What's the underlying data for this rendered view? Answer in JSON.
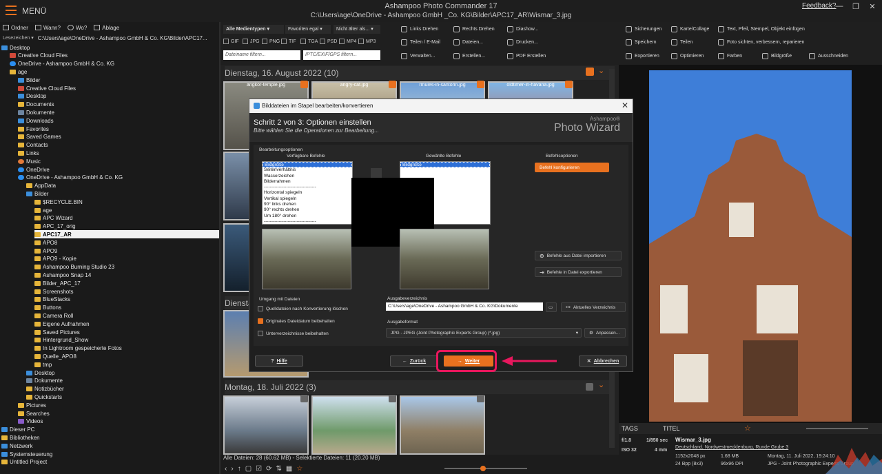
{
  "titlebar": {
    "menu_label": "MENÜ",
    "app_title": "Ashampoo Photo Commander 17",
    "path": "C:\\Users\\age\\OneDrive - Ashampoo GmbH _Co. KG\\Bilder\\APC17_AR\\Wismar_3.jpg",
    "feedback": "Feedback?",
    "minimize": "—",
    "restore": "❐",
    "close": "✕"
  },
  "left": {
    "toolbar": {
      "ordner": "Ordner",
      "wann": "Wann?",
      "wo": "Wo?",
      "ablage": "Ablage"
    },
    "bookmark_label": "Lesezeichen ▾",
    "bookmark_path": "C:\\Users\\age\\OneDrive - Ashampoo GmbH & Co. KG\\Bilder\\APC17...",
    "tree": [
      {
        "label": "Desktop",
        "indent": 0,
        "icon": "blue"
      },
      {
        "label": "Creative Cloud Files",
        "indent": 1,
        "icon": "red"
      },
      {
        "label": "OneDrive - Ashampoo GmbH & Co. KG",
        "indent": 1,
        "icon": "cloud"
      },
      {
        "label": "age",
        "indent": 1,
        "icon": "folder"
      },
      {
        "label": "Bilder",
        "indent": 2,
        "icon": "blue"
      },
      {
        "label": "Creative Cloud Files",
        "indent": 2,
        "icon": "red"
      },
      {
        "label": "Desktop",
        "indent": 2,
        "icon": "blue"
      },
      {
        "label": "Documents",
        "indent": 2,
        "icon": "folder"
      },
      {
        "label": "Dokumente",
        "indent": 2,
        "icon": "gray"
      },
      {
        "label": "Downloads",
        "indent": 2,
        "icon": "blue"
      },
      {
        "label": "Favorites",
        "indent": 2,
        "icon": "folder"
      },
      {
        "label": "Saved Games",
        "indent": 2,
        "icon": "folder"
      },
      {
        "label": "Contacts",
        "indent": 2,
        "icon": "folder"
      },
      {
        "label": "Links",
        "indent": 2,
        "icon": "folder"
      },
      {
        "label": "Music",
        "indent": 2,
        "icon": "music"
      },
      {
        "label": "OneDrive",
        "indent": 2,
        "icon": "cloud"
      },
      {
        "label": "OneDrive - Ashampoo GmbH & Co. KG",
        "indent": 2,
        "icon": "cloud"
      },
      {
        "label": "AppData",
        "indent": 3,
        "icon": "folder"
      },
      {
        "label": "Bilder",
        "indent": 3,
        "icon": "blue"
      },
      {
        "label": "$RECYCLE.BIN",
        "indent": 4,
        "icon": "folder"
      },
      {
        "label": "age",
        "indent": 4,
        "icon": "folder"
      },
      {
        "label": "APC Wizard",
        "indent": 4,
        "icon": "folder"
      },
      {
        "label": "APC_17_orig",
        "indent": 4,
        "icon": "folder"
      },
      {
        "label": "APC17_AR",
        "indent": 4,
        "icon": "folder",
        "selected": true
      },
      {
        "label": "APO8",
        "indent": 4,
        "icon": "folder"
      },
      {
        "label": "APO9",
        "indent": 4,
        "icon": "folder"
      },
      {
        "label": "APO9 - Kopie",
        "indent": 4,
        "icon": "folder"
      },
      {
        "label": "Ashampoo Burning Studio 23",
        "indent": 4,
        "icon": "folder"
      },
      {
        "label": "Ashampoo Snap 14",
        "indent": 4,
        "icon": "folder"
      },
      {
        "label": "Bilder_APC_17",
        "indent": 4,
        "icon": "folder"
      },
      {
        "label": "Screenshots",
        "indent": 4,
        "icon": "folder"
      },
      {
        "label": "BlueStacks",
        "indent": 4,
        "icon": "folder"
      },
      {
        "label": "Buttons",
        "indent": 4,
        "icon": "folder"
      },
      {
        "label": "Camera Roll",
        "indent": 4,
        "icon": "folder"
      },
      {
        "label": "Eigene Aufnahmen",
        "indent": 4,
        "icon": "folder"
      },
      {
        "label": "Saved Pictures",
        "indent": 4,
        "icon": "folder"
      },
      {
        "label": "Hintergrund_Show",
        "indent": 4,
        "icon": "folder"
      },
      {
        "label": "In Lightroom gespeicherte Fotos",
        "indent": 4,
        "icon": "folder"
      },
      {
        "label": "Quelle_APO8",
        "indent": 4,
        "icon": "folder"
      },
      {
        "label": "tmp",
        "indent": 4,
        "icon": "folder"
      },
      {
        "label": "Desktop",
        "indent": 3,
        "icon": "blue"
      },
      {
        "label": "Dokumente",
        "indent": 3,
        "icon": "gray"
      },
      {
        "label": "Notizbücher",
        "indent": 3,
        "icon": "folder"
      },
      {
        "label": "Quickstarts",
        "indent": 3,
        "icon": "folder"
      },
      {
        "label": "Pictures",
        "indent": 2,
        "icon": "folder"
      },
      {
        "label": "Searches",
        "indent": 2,
        "icon": "folder"
      },
      {
        "label": "Videos",
        "indent": 2,
        "icon": "purple"
      },
      {
        "label": "Dieser PC",
        "indent": 0,
        "icon": "blue"
      },
      {
        "label": "Bibliotheken",
        "indent": 0,
        "icon": "folder"
      },
      {
        "label": "Netzwerk",
        "indent": 0,
        "icon": "blue"
      },
      {
        "label": "Systemsteuerung",
        "indent": 0,
        "icon": "blue"
      },
      {
        "label": "Untitled Project",
        "indent": 0,
        "icon": "folder"
      }
    ]
  },
  "center_toolbar": {
    "media_type": "Alle Medientypen",
    "favorites": "Favoriten egal",
    "age": "Nicht älter als...",
    "formats": [
      "GIF",
      "JPG",
      "PNG",
      "TIF",
      "TGA",
      "PSD",
      "MP4",
      "MP3"
    ],
    "name_filter_placeholder": "Dateiname filtern...",
    "iptc_filter_placeholder": "IPTC/EXIF/GPS filtern...",
    "actions": [
      "Links Drehen",
      "Rechts Drehen",
      "Diashow...",
      "Teilen / E-Mail",
      "Dateien...",
      "Drucken...",
      "Verwalten...",
      "Erstellen...",
      "PDF Erstellen"
    ]
  },
  "right_toolbar": {
    "actions": [
      "Sicherungen",
      "Karte/Collage",
      "Text, Pfeil, Stempel, Objekt einfügen",
      "Speichern",
      "Teilen",
      "Foto sichten, verbessern, reparieren",
      "Exportieren",
      "Optimieren",
      "Farben",
      "Bildgröße",
      "Ausschneiden"
    ]
  },
  "gallery": {
    "group1": "Dienstag, 16. August 2022 (10)",
    "group1_thumbs": [
      "angkor-temple.jpg",
      "angry-cat.jpg",
      "rmules-in-santorin.jpg",
      "oldtimer-in-havana.jpg"
    ],
    "group2_partial": "Diensta",
    "group3": "Montag, 18. Juli 2022 (3)",
    "status": "Alle Dateien: 28 (60.62 MB) - Selektierte Dateien: 11 (20.20 MB)"
  },
  "right_panel": {
    "tab_tags": "TAGS",
    "tab_titel": "TITEL",
    "exif_aperture": "f/1.8",
    "exif_shutter": "1/850 sec",
    "exif_iso": "ISO 32",
    "exif_focal": "4 mm",
    "file_name": "Wismar_3.jpg",
    "location": "Deutschland, Nordwestmecklenburg, Runde Grube 3",
    "dims": "1152x2048 px",
    "size": "1.68 MB",
    "date": "Montag, 11. Juli 2022, 19:24:10",
    "bpp": "24 Bpp (8x3)",
    "dpi": "96x96 DPI",
    "format": "JPG - Joint Photographic Experts Group"
  },
  "dialog": {
    "title": "Bilddateien im Stapel bearbeiten/konvertieren",
    "step": "Schritt 2 von 3: Optionen einstellen",
    "subtitle": "Bitte wählen Sie die Operationen zur Bearbeitung...",
    "brand_small": "Ashampoo®",
    "brand_large": "Photo Wizard",
    "section_edit": "Bearbeitungsoptionen",
    "available_label": "Verfügbare Befehle",
    "available": [
      "Bildgröße",
      "Seitenverhältnis",
      "Wasserzeichen",
      "Bilderrahmen",
      "-----------------------------------",
      "Horizontal spiegeln",
      "Vertikal spiegeln",
      "90° links drehen",
      "90° rechts drehen",
      "Um 180° drehen",
      "-----------------------------------"
    ],
    "chosen_label": "Gewählte Befehle",
    "chosen": [
      "Bildgröße"
    ],
    "command_options_label": "Befehlsoptionen",
    "configure_btn": "Befehl konfigurieren",
    "import_btn": "Befehle aus Datei importieren",
    "export_btn": "Befehle in Datei exportieren",
    "file_handling_label": "Umgang mit Dateien",
    "chk_delete_sources": "Quelldateien nach Konvertierung löschen",
    "chk_keep_date": "Originales Dateidatum beibehalten",
    "chk_keep_subdirs": "Unterverzeichnisse beibehalten",
    "output_dir_label": "Ausgabeverzeichnis",
    "output_dir": "C:\\Users\\age\\OneDrive - Ashampoo GmbH & Co. KG\\Dokumente",
    "current_dir_btn": "Aktuelles Verzeichnis",
    "output_format_label": "Ausgabeformat",
    "output_format": "JPG - JPEG (Joint Photographic Experts Group) (*.jpg)",
    "adjust_btn": "Anpassen...",
    "help_btn": "Hilfe",
    "back_btn": "Zurück",
    "next_btn": "Weiter",
    "cancel_btn": "Abbrechen"
  },
  "colors": {
    "accent": "#e8711f",
    "highlight": "#e8175d"
  }
}
